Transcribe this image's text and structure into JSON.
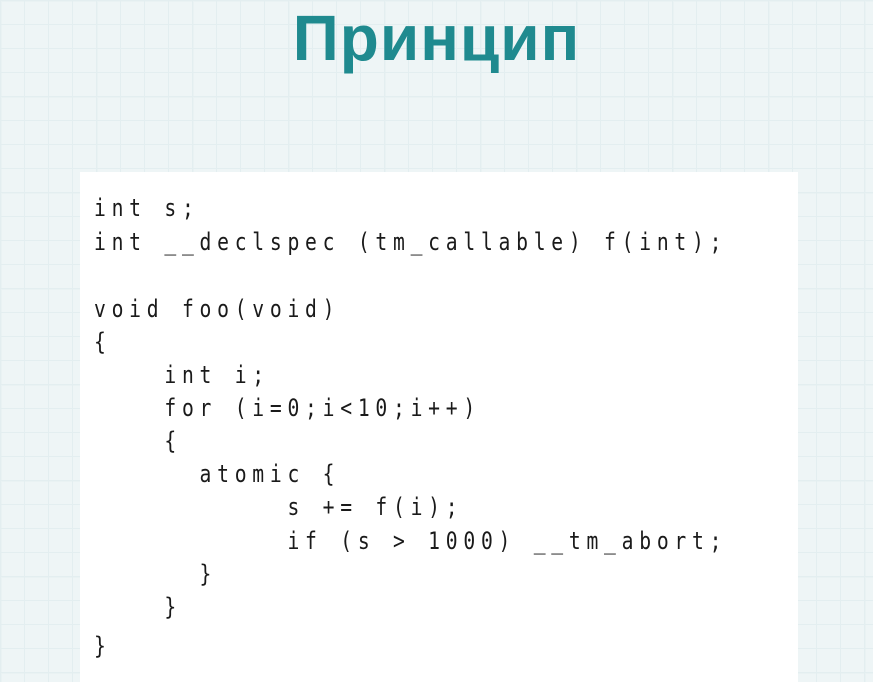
{
  "slide": {
    "title": "Принцип"
  },
  "code": {
    "lines": [
      "int s;",
      "int __declspec (tm_callable) f(int);",
      "",
      "void foo(void)",
      "{",
      "    int i;",
      "    for (i=0;i<10;i++)",
      "    {",
      "      atomic {",
      "           s += f(i);",
      "           if (s > 1000) __tm_abort;",
      "      }",
      "    }",
      "}"
    ]
  },
  "colors": {
    "title": "#1f8a8f",
    "background": "#eef5f6",
    "code_panel": "#ffffff",
    "code_text": "#1a1a1a"
  }
}
